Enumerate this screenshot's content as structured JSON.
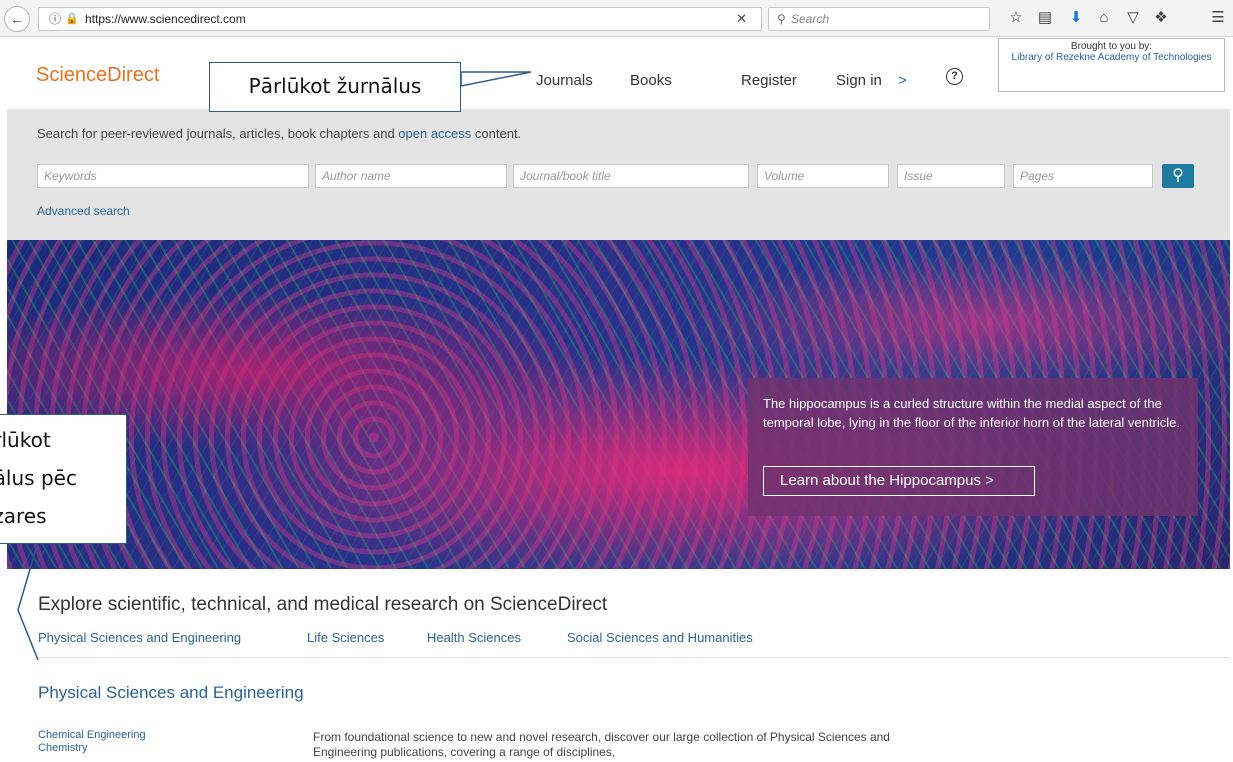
{
  "browser": {
    "url": "https://www.sciencedirect.com",
    "search_placeholder": "Search",
    "icons": [
      "back-icon",
      "info-icon",
      "lock-icon",
      "clear-icon",
      "search-icon",
      "star-icon",
      "reader-icon",
      "download-icon",
      "home-icon",
      "pocket-icon",
      "extension-icon",
      "menu-icon"
    ]
  },
  "header": {
    "logo": "ScienceDirect",
    "nav": {
      "journals": "Journals",
      "books": "Books",
      "register": "Register",
      "signin": "Sign in",
      "signin_arrow": ">",
      "help": "?"
    },
    "brought": {
      "line1": "Brought to you by:",
      "line2": "Library of Rezekne Academy of Technologies"
    }
  },
  "search": {
    "intro_before": "Search for peer-reviewed journals, articles, book chapters and ",
    "intro_link": "open access",
    "intro_after": " content.",
    "fields": {
      "keywords": "Keywords",
      "author": "Author name",
      "journal": "Journal/book title",
      "volume": "Volume",
      "issue": "Issue",
      "pages": "Pages"
    },
    "advanced": "Advanced search"
  },
  "hero": {
    "text": "The hippocampus is a curled structure within the medial aspect of the temporal lobe, lying in the floor of the inferior horn of the lateral ventricle.",
    "button": "Learn about the Hippocampus >"
  },
  "explore": {
    "title": "Explore scientific, technical, and medical research on ScienceDirect",
    "categories": [
      "Physical Sciences and Engineering",
      "Life Sciences",
      "Health Sciences",
      "Social Sciences and Humanities"
    ]
  },
  "section": {
    "heading": "Physical Sciences and Engineering",
    "subjects": [
      "Chemical Engineering",
      "Chemistry"
    ],
    "description": "From foundational science to new and novel research, discover our large collection of Physical Sciences and Engineering publications, covering a range of disciplines,"
  },
  "annotations": {
    "journals_callout": "Pārlūkot žurnālus",
    "field_callout": [
      "ārlūkot",
      "nālus pēc",
      "ozares"
    ]
  },
  "colors": {
    "brand": "#e9711c",
    "link": "#2a6496",
    "search_button": "#1e7a9e",
    "callout_border": "#2e5b8a"
  }
}
